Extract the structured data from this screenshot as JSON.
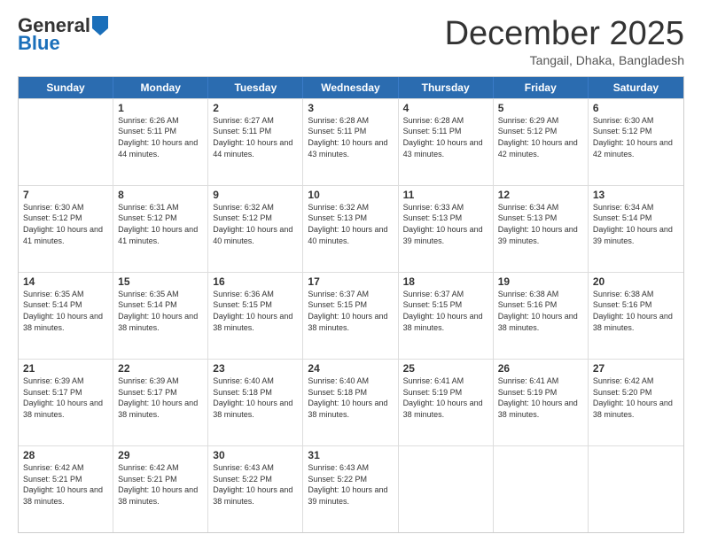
{
  "logo": {
    "general": "General",
    "blue": "Blue"
  },
  "title": "December 2025",
  "subtitle": "Tangail, Dhaka, Bangladesh",
  "days": [
    "Sunday",
    "Monday",
    "Tuesday",
    "Wednesday",
    "Thursday",
    "Friday",
    "Saturday"
  ],
  "weeks": [
    [
      {
        "day": "",
        "info": ""
      },
      {
        "day": "1",
        "info": "Sunrise: 6:26 AM\nSunset: 5:11 PM\nDaylight: 10 hours and 44 minutes."
      },
      {
        "day": "2",
        "info": "Sunrise: 6:27 AM\nSunset: 5:11 PM\nDaylight: 10 hours and 44 minutes."
      },
      {
        "day": "3",
        "info": "Sunrise: 6:28 AM\nSunset: 5:11 PM\nDaylight: 10 hours and 43 minutes."
      },
      {
        "day": "4",
        "info": "Sunrise: 6:28 AM\nSunset: 5:11 PM\nDaylight: 10 hours and 43 minutes."
      },
      {
        "day": "5",
        "info": "Sunrise: 6:29 AM\nSunset: 5:12 PM\nDaylight: 10 hours and 42 minutes."
      },
      {
        "day": "6",
        "info": "Sunrise: 6:30 AM\nSunset: 5:12 PM\nDaylight: 10 hours and 42 minutes."
      }
    ],
    [
      {
        "day": "7",
        "info": "Sunrise: 6:30 AM\nSunset: 5:12 PM\nDaylight: 10 hours and 41 minutes."
      },
      {
        "day": "8",
        "info": "Sunrise: 6:31 AM\nSunset: 5:12 PM\nDaylight: 10 hours and 41 minutes."
      },
      {
        "day": "9",
        "info": "Sunrise: 6:32 AM\nSunset: 5:12 PM\nDaylight: 10 hours and 40 minutes."
      },
      {
        "day": "10",
        "info": "Sunrise: 6:32 AM\nSunset: 5:13 PM\nDaylight: 10 hours and 40 minutes."
      },
      {
        "day": "11",
        "info": "Sunrise: 6:33 AM\nSunset: 5:13 PM\nDaylight: 10 hours and 39 minutes."
      },
      {
        "day": "12",
        "info": "Sunrise: 6:34 AM\nSunset: 5:13 PM\nDaylight: 10 hours and 39 minutes."
      },
      {
        "day": "13",
        "info": "Sunrise: 6:34 AM\nSunset: 5:14 PM\nDaylight: 10 hours and 39 minutes."
      }
    ],
    [
      {
        "day": "14",
        "info": "Sunrise: 6:35 AM\nSunset: 5:14 PM\nDaylight: 10 hours and 38 minutes."
      },
      {
        "day": "15",
        "info": "Sunrise: 6:35 AM\nSunset: 5:14 PM\nDaylight: 10 hours and 38 minutes."
      },
      {
        "day": "16",
        "info": "Sunrise: 6:36 AM\nSunset: 5:15 PM\nDaylight: 10 hours and 38 minutes."
      },
      {
        "day": "17",
        "info": "Sunrise: 6:37 AM\nSunset: 5:15 PM\nDaylight: 10 hours and 38 minutes."
      },
      {
        "day": "18",
        "info": "Sunrise: 6:37 AM\nSunset: 5:15 PM\nDaylight: 10 hours and 38 minutes."
      },
      {
        "day": "19",
        "info": "Sunrise: 6:38 AM\nSunset: 5:16 PM\nDaylight: 10 hours and 38 minutes."
      },
      {
        "day": "20",
        "info": "Sunrise: 6:38 AM\nSunset: 5:16 PM\nDaylight: 10 hours and 38 minutes."
      }
    ],
    [
      {
        "day": "21",
        "info": "Sunrise: 6:39 AM\nSunset: 5:17 PM\nDaylight: 10 hours and 38 minutes."
      },
      {
        "day": "22",
        "info": "Sunrise: 6:39 AM\nSunset: 5:17 PM\nDaylight: 10 hours and 38 minutes."
      },
      {
        "day": "23",
        "info": "Sunrise: 6:40 AM\nSunset: 5:18 PM\nDaylight: 10 hours and 38 minutes."
      },
      {
        "day": "24",
        "info": "Sunrise: 6:40 AM\nSunset: 5:18 PM\nDaylight: 10 hours and 38 minutes."
      },
      {
        "day": "25",
        "info": "Sunrise: 6:41 AM\nSunset: 5:19 PM\nDaylight: 10 hours and 38 minutes."
      },
      {
        "day": "26",
        "info": "Sunrise: 6:41 AM\nSunset: 5:19 PM\nDaylight: 10 hours and 38 minutes."
      },
      {
        "day": "27",
        "info": "Sunrise: 6:42 AM\nSunset: 5:20 PM\nDaylight: 10 hours and 38 minutes."
      }
    ],
    [
      {
        "day": "28",
        "info": "Sunrise: 6:42 AM\nSunset: 5:21 PM\nDaylight: 10 hours and 38 minutes."
      },
      {
        "day": "29",
        "info": "Sunrise: 6:42 AM\nSunset: 5:21 PM\nDaylight: 10 hours and 38 minutes."
      },
      {
        "day": "30",
        "info": "Sunrise: 6:43 AM\nSunset: 5:22 PM\nDaylight: 10 hours and 38 minutes."
      },
      {
        "day": "31",
        "info": "Sunrise: 6:43 AM\nSunset: 5:22 PM\nDaylight: 10 hours and 39 minutes."
      },
      {
        "day": "",
        "info": ""
      },
      {
        "day": "",
        "info": ""
      },
      {
        "day": "",
        "info": ""
      }
    ]
  ]
}
